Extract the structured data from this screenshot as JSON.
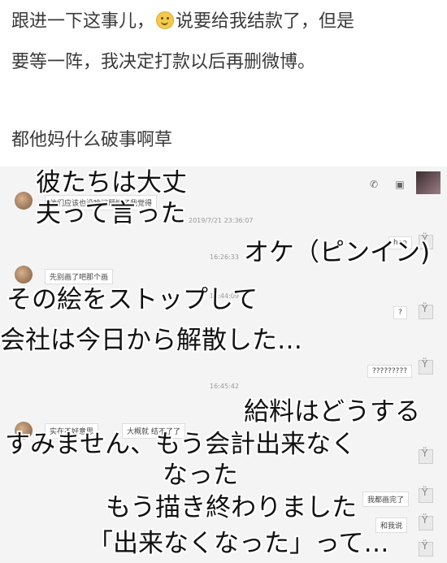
{
  "post": {
    "line1_a": "跟进一下这事儿，",
    "line1_b": "说要给我结款了，但是",
    "line2": "要等一阵，我决定打款以后再删微博。",
    "line3": "都他妈什么破事啊草"
  },
  "chat": {
    "msg1": "他们应该也没啥问题惯了我觉得",
    "time1": "2019/7/21 23:36:07",
    "msg_hao": "hao",
    "time2": "16:26:33",
    "msg2": "先别画了吧那个画",
    "time3": "16:44:09",
    "msg_q": "?",
    "msg_qqq": "?????????",
    "time4": "16:45:42",
    "msg3a": "实在不好意思",
    "msg3b": "大概就 结不了了",
    "msg_done": "我都画完了",
    "msg_why": "和我说"
  },
  "overlay": {
    "l1": "彼たちは大丈",
    "l2": "夫って言った",
    "l3": "オケ（ピンイン)",
    "l4": "その絵をストップして",
    "l5": "会社は今日から解散した…",
    "l6": "給料はどうする",
    "l7": "すみません、もう会計出来なく",
    "l8": "なった",
    "l9": "もう描き終わりました",
    "l10": "「出来なくなった」って…"
  }
}
